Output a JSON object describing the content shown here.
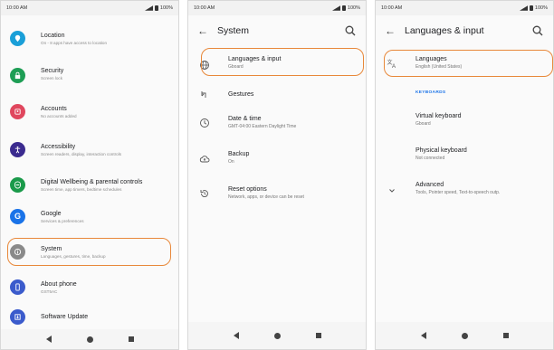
{
  "status_time": "10:00 AM",
  "status_battery": "100%",
  "panel1": {
    "items": [
      {
        "title": "Location",
        "subtitle": "On - 8 apps have access to location",
        "icon": "location-icon",
        "color": "#1a9fd8"
      },
      {
        "title": "Security",
        "subtitle": "Screen lock",
        "icon": "lock-icon",
        "color": "#1e9e55"
      },
      {
        "title": "Accounts",
        "subtitle": "No accounts added",
        "icon": "accounts-icon",
        "color": "#e0475e"
      },
      {
        "title": "Accessibility",
        "subtitle": "Screen readers, display, interaction controls",
        "icon": "accessibility-icon",
        "color": "#3b2b8f"
      },
      {
        "title": "Digital Wellbeing & parental controls",
        "subtitle": "Screen time, app timers, bedtime schedules",
        "icon": "wellbeing-icon",
        "color": "#1a9a4a"
      },
      {
        "title": "Google",
        "subtitle": "Services & preferences",
        "icon": "google-icon",
        "color": "#1a73e8"
      },
      {
        "title": "System",
        "subtitle": "Languages, gestures, time, backup",
        "icon": "system-info-icon",
        "color": "#8a8a8a"
      },
      {
        "title": "About phone",
        "subtitle": "GST5AC",
        "icon": "phone-icon",
        "color": "#3b5bcc"
      },
      {
        "title": "Software Update",
        "subtitle": "",
        "icon": "software-update-icon",
        "color": "#3b5bcc"
      }
    ]
  },
  "panel2": {
    "title": "System",
    "items": [
      {
        "title": "Languages & input",
        "subtitle": "Gboard",
        "icon": "globe-icon"
      },
      {
        "title": "Gestures",
        "subtitle": "",
        "icon": "gestures-icon"
      },
      {
        "title": "Date & time",
        "subtitle": "GMT-04:00 Eastern Daylight Time",
        "icon": "clock-icon"
      },
      {
        "title": "Backup",
        "subtitle": "On",
        "icon": "cloud-backup-icon"
      },
      {
        "title": "Reset options",
        "subtitle": "Network, apps, or device can be reset",
        "icon": "reset-icon"
      }
    ]
  },
  "panel3": {
    "title": "Languages & input",
    "languages": {
      "title": "Languages",
      "subtitle": "English (United States)",
      "icon": "translate-icon"
    },
    "section_label": "KEYBOARDS",
    "items": [
      {
        "title": "Virtual keyboard",
        "subtitle": "Gboard"
      },
      {
        "title": "Physical keyboard",
        "subtitle": "Not connected"
      },
      {
        "title": "Advanced",
        "subtitle": "Tools, Pointer speed, Text-to-speech outp.",
        "icon": "chevron-down-icon"
      }
    ]
  },
  "colors": {
    "highlight": "#e8883a",
    "accent": "#1a73e8"
  }
}
